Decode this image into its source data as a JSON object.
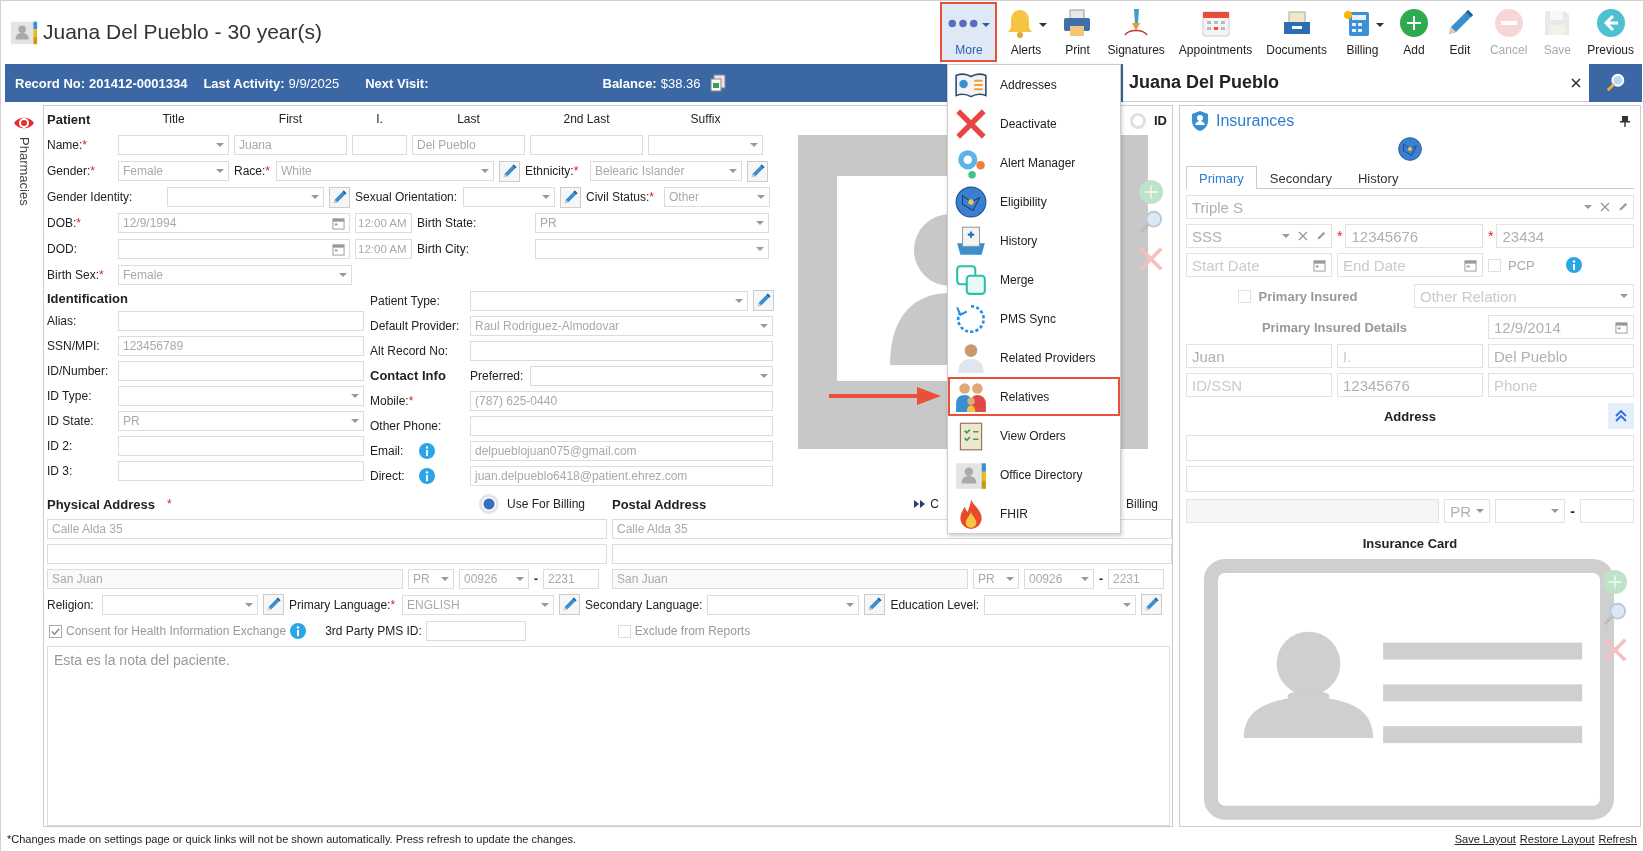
{
  "header": {
    "title": "Juana Del Pueblo - 30 year(s)"
  },
  "toolbar": [
    {
      "label": "More",
      "dropdown": true,
      "selected": true,
      "disabled": false
    },
    {
      "label": "Alerts",
      "dropdown": true,
      "selected": false,
      "disabled": false
    },
    {
      "label": "Print",
      "dropdown": false,
      "selected": false,
      "disabled": false
    },
    {
      "label": "Signatures",
      "dropdown": false,
      "selected": false,
      "disabled": false
    },
    {
      "label": "Appointments",
      "dropdown": false,
      "selected": false,
      "disabled": false
    },
    {
      "label": "Documents",
      "dropdown": false,
      "selected": false,
      "disabled": false
    },
    {
      "label": "Billing",
      "dropdown": true,
      "selected": false,
      "disabled": false
    },
    {
      "label": "Add",
      "dropdown": false,
      "selected": false,
      "disabled": false
    },
    {
      "label": "Edit",
      "dropdown": false,
      "selected": false,
      "disabled": false
    },
    {
      "label": "Cancel",
      "dropdown": false,
      "selected": false,
      "disabled": true
    },
    {
      "label": "Save",
      "dropdown": false,
      "selected": false,
      "disabled": true
    },
    {
      "label": "Previous",
      "dropdown": false,
      "selected": false,
      "disabled": false
    }
  ],
  "info_bar": {
    "record_label": "Record No:",
    "record": "201412-0001334",
    "activity_label": "Last Activity:",
    "activity": "9/9/2025",
    "next_visit_label": "Next Visit:",
    "balance_label": "Balance:",
    "balance": "$38.36"
  },
  "side_tab": {
    "label": "Pharmacies"
  },
  "patient": {
    "rows": [
      [
        {
          "kind": "heading",
          "text": "Patient"
        },
        {
          "kind": "colhead",
          "text": "Title"
        },
        {
          "kind": "colhead",
          "text": "First"
        },
        {
          "kind": "colhead",
          "text": "I."
        },
        {
          "kind": "colhead",
          "text": "Last"
        },
        {
          "kind": "colhead",
          "text": "2nd Last"
        },
        {
          "kind": "colhead",
          "text": "Suffix"
        }
      ],
      [
        {
          "kind": "label",
          "text": "Name:",
          "required_mark": "*"
        },
        {
          "kind": "select"
        },
        {
          "kind": "input",
          "value": "Juana"
        },
        {
          "kind": "input"
        },
        {
          "kind": "input",
          "value": "Del Pueblo"
        },
        {
          "kind": "input"
        },
        {
          "kind": "select"
        }
      ],
      [
        {
          "kind": "label",
          "text": "Gender:",
          "required_mark": "*"
        },
        {
          "kind": "select",
          "value": "Female"
        },
        {
          "kind": "label",
          "text": "Race:",
          "required_mark": "*"
        },
        {
          "kind": "select",
          "value": "White"
        },
        {
          "kind": "edit"
        },
        {
          "kind": "label",
          "text": "Ethnicity:",
          "required_mark": "*"
        },
        {
          "kind": "select",
          "value": "Belearic Islander"
        },
        {
          "kind": "edit"
        }
      ],
      [
        {
          "kind": "label",
          "text": "Gender Identity:"
        },
        {
          "kind": "select"
        },
        {
          "kind": "edit"
        },
        {
          "kind": "label",
          "text": "Sexual Orientation:"
        },
        {
          "kind": "select"
        },
        {
          "kind": "edit"
        },
        {
          "kind": "label",
          "text": "Civil Status:",
          "required_mark": "*"
        },
        {
          "kind": "select",
          "value": "Other"
        }
      ],
      [
        {
          "kind": "label",
          "text": "DOB:",
          "required_mark": "*"
        },
        {
          "kind": "date",
          "value": "12/9/1994"
        },
        {
          "kind": "time",
          "value": "12:00 AM"
        },
        {
          "kind": "label",
          "text": "Birth State:"
        },
        {
          "kind": "select",
          "value": "PR"
        }
      ],
      [
        {
          "kind": "label",
          "text": "DOD:"
        },
        {
          "kind": "date"
        },
        {
          "kind": "time",
          "value": "12:00 AM"
        },
        {
          "kind": "label",
          "text": "Birth City:"
        },
        {
          "kind": "select"
        }
      ],
      [
        {
          "kind": "label",
          "text": "Birth Sex:",
          "required_mark": "*"
        },
        {
          "kind": "select",
          "value": "Female"
        }
      ]
    ]
  },
  "identification": {
    "rows": [
      [
        {
          "kind": "heading",
          "text": "Identification"
        }
      ],
      [
        {
          "kind": "label",
          "text": "Alias:"
        },
        {
          "kind": "input"
        }
      ],
      [
        {
          "kind": "label",
          "text": "SSN/MPI:"
        },
        {
          "kind": "input",
          "value": "123456789"
        }
      ],
      [
        {
          "kind": "label",
          "text": "ID/Number:"
        },
        {
          "kind": "input"
        }
      ],
      [
        {
          "kind": "label",
          "text": "ID Type:"
        },
        {
          "kind": "select"
        }
      ],
      [
        {
          "kind": "label",
          "text": "ID State:"
        },
        {
          "kind": "select",
          "value": "PR"
        }
      ],
      [
        {
          "kind": "label",
          "text": "ID 2:"
        },
        {
          "kind": "input"
        }
      ],
      [
        {
          "kind": "label",
          "text": "ID 3:"
        },
        {
          "kind": "input"
        }
      ]
    ]
  },
  "details": {
    "rows": [
      [
        {
          "kind": "label",
          "text": "Patient Type:"
        },
        {
          "kind": "select"
        },
        {
          "kind": "edit"
        }
      ],
      [
        {
          "kind": "label",
          "text": "Default Provider:"
        },
        {
          "kind": "select",
          "value": "Raul Rodriguez-Almodovar"
        }
      ],
      [
        {
          "kind": "label",
          "text": "Alt Record No:"
        },
        {
          "kind": "input"
        }
      ],
      [
        {
          "kind": "heading",
          "text": "Contact Info"
        },
        {
          "kind": "label",
          "text": "Preferred:"
        },
        {
          "kind": "select"
        }
      ],
      [
        {
          "kind": "label",
          "text": "Mobile:",
          "required_mark": "*"
        },
        {
          "kind": "input",
          "value": "(787) 625-0440"
        }
      ],
      [
        {
          "kind": "label",
          "text": "Other Phone:"
        },
        {
          "kind": "input"
        }
      ],
      [
        {
          "kind": "label",
          "text": "Email:"
        },
        {
          "kind": "info"
        },
        {
          "kind": "input",
          "value": "delpueblojuan075@gmail.com"
        }
      ],
      [
        {
          "kind": "label",
          "text": "Direct:"
        },
        {
          "kind": "info"
        },
        {
          "kind": "input",
          "value": "juan.delpueblo6418@patient.ehrez.com"
        }
      ]
    ]
  },
  "photo": {
    "id_toggle": {
      "label": "ID",
      "on": false
    }
  },
  "physical_address": {
    "title": "Physical Address",
    "required_mark": "*",
    "billing_radio": {
      "label": "Use For Billing",
      "selected": true
    },
    "street": "Calle Alda 35",
    "city": "San Juan",
    "state": "PR",
    "zip": "00926",
    "zip_separator": "-",
    "zip_ext": "2231"
  },
  "postal_address": {
    "title": "Postal Address",
    "toggle_fragment": "C",
    "toggle_tail": "Billing",
    "street": "Calle Alda 35",
    "city": "San Juan",
    "state": "PR",
    "zip": "00926",
    "zip_separator": "-",
    "zip_ext": "2231"
  },
  "languages": {
    "items": [
      {
        "kind": "label",
        "text": "Religion:"
      },
      {
        "kind": "select"
      },
      {
        "kind": "edit"
      },
      {
        "kind": "label",
        "text": "Primary Language:",
        "required_mark": "*"
      },
      {
        "kind": "select",
        "value": "ENGLISH"
      },
      {
        "kind": "edit"
      },
      {
        "kind": "label",
        "text": "Secondary Language:"
      },
      {
        "kind": "select"
      },
      {
        "kind": "edit"
      },
      {
        "kind": "label",
        "text": "Education Level:"
      },
      {
        "kind": "select"
      },
      {
        "kind": "edit"
      }
    ]
  },
  "consent": {
    "label": "Consent for Health Information Exchange",
    "checked": true
  },
  "third_party": {
    "label": "3rd Party PMS ID:"
  },
  "exclude": {
    "label": "Exclude from Reports",
    "checked": false
  },
  "notes": "Esta es la nota del paciente.",
  "more_menu": {
    "items": [
      {
        "label": "Addresses",
        "selected": false
      },
      {
        "label": "Deactivate",
        "selected": false
      },
      {
        "label": "Alert Manager",
        "selected": false
      },
      {
        "label": "Eligibility",
        "selected": false
      },
      {
        "label": "History",
        "selected": false
      },
      {
        "label": "Merge",
        "selected": false
      },
      {
        "label": "PMS Sync",
        "selected": false
      },
      {
        "label": "Related Providers",
        "selected": false
      },
      {
        "label": "Relatives",
        "selected": true
      },
      {
        "label": "View Orders",
        "selected": false
      },
      {
        "label": "Office Directory",
        "selected": false
      },
      {
        "label": "FHIR",
        "selected": false
      }
    ]
  },
  "side_panel": {
    "title": "Juana Del Pueblo"
  },
  "insurance": {
    "title": "Insurances",
    "tabs": [
      {
        "label": "Primary",
        "selected": true
      },
      {
        "label": "Secondary",
        "selected": false
      },
      {
        "label": "History",
        "selected": false
      }
    ],
    "plan": "Triple S",
    "subplan": "SSS",
    "policy_mark": "*",
    "policy": "12345676",
    "group_mark": "*",
    "group": "23434",
    "start_placeholder": "Start Date",
    "end_placeholder": "End Date",
    "pcp": {
      "label": "PCP",
      "checked": false
    },
    "primary_insured": {
      "label": "Primary Insured",
      "checked": false
    },
    "relation_placeholder": "Other Relation",
    "details_heading": "Primary Insured Details",
    "insured_dob": "12/9/2014",
    "insured_first": "Juan",
    "insured_middle_placeholder": "I.",
    "insured_last": "Del Pueblo",
    "insured_id_placeholder": "ID/SSN",
    "insured_id_number": "12345676",
    "insured_phone_placeholder": "Phone",
    "address_heading": "Address",
    "address_state": "PR",
    "zip_separator": "-",
    "card_heading": "Insurance Card"
  },
  "footer": {
    "note": "*Changes made on settings page or quick links will not be shown automatically. Press refresh to update the changes.",
    "links": [
      {
        "label": "Save Layout"
      },
      {
        "label": "Restore Layout"
      },
      {
        "label": "Refresh"
      }
    ]
  }
}
